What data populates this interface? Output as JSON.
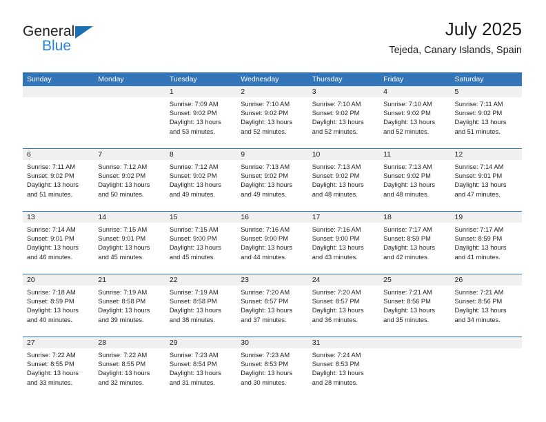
{
  "brand": {
    "name_top": "General",
    "name_bottom": "Blue",
    "triangle_color": "#1c6fb5",
    "blue_color": "#2387d4"
  },
  "header": {
    "title": "July 2025",
    "subtitle": "Tejeda, Canary Islands, Spain",
    "header_bg": "#3275b9",
    "daynum_bg": "#f0f0f0"
  },
  "weekdays": [
    "Sunday",
    "Monday",
    "Tuesday",
    "Wednesday",
    "Thursday",
    "Friday",
    "Saturday"
  ],
  "weeks": [
    [
      {
        "day": "",
        "lines": [
          "",
          "",
          "",
          ""
        ]
      },
      {
        "day": "",
        "lines": [
          "",
          "",
          "",
          ""
        ]
      },
      {
        "day": "1",
        "lines": [
          "Sunrise: 7:09 AM",
          "Sunset: 9:02 PM",
          "Daylight: 13 hours",
          "and 53 minutes."
        ]
      },
      {
        "day": "2",
        "lines": [
          "Sunrise: 7:10 AM",
          "Sunset: 9:02 PM",
          "Daylight: 13 hours",
          "and 52 minutes."
        ]
      },
      {
        "day": "3",
        "lines": [
          "Sunrise: 7:10 AM",
          "Sunset: 9:02 PM",
          "Daylight: 13 hours",
          "and 52 minutes."
        ]
      },
      {
        "day": "4",
        "lines": [
          "Sunrise: 7:10 AM",
          "Sunset: 9:02 PM",
          "Daylight: 13 hours",
          "and 52 minutes."
        ]
      },
      {
        "day": "5",
        "lines": [
          "Sunrise: 7:11 AM",
          "Sunset: 9:02 PM",
          "Daylight: 13 hours",
          "and 51 minutes."
        ]
      }
    ],
    [
      {
        "day": "6",
        "lines": [
          "Sunrise: 7:11 AM",
          "Sunset: 9:02 PM",
          "Daylight: 13 hours",
          "and 51 minutes."
        ]
      },
      {
        "day": "7",
        "lines": [
          "Sunrise: 7:12 AM",
          "Sunset: 9:02 PM",
          "Daylight: 13 hours",
          "and 50 minutes."
        ]
      },
      {
        "day": "8",
        "lines": [
          "Sunrise: 7:12 AM",
          "Sunset: 9:02 PM",
          "Daylight: 13 hours",
          "and 49 minutes."
        ]
      },
      {
        "day": "9",
        "lines": [
          "Sunrise: 7:13 AM",
          "Sunset: 9:02 PM",
          "Daylight: 13 hours",
          "and 49 minutes."
        ]
      },
      {
        "day": "10",
        "lines": [
          "Sunrise: 7:13 AM",
          "Sunset: 9:02 PM",
          "Daylight: 13 hours",
          "and 48 minutes."
        ]
      },
      {
        "day": "11",
        "lines": [
          "Sunrise: 7:13 AM",
          "Sunset: 9:02 PM",
          "Daylight: 13 hours",
          "and 48 minutes."
        ]
      },
      {
        "day": "12",
        "lines": [
          "Sunrise: 7:14 AM",
          "Sunset: 9:01 PM",
          "Daylight: 13 hours",
          "and 47 minutes."
        ]
      }
    ],
    [
      {
        "day": "13",
        "lines": [
          "Sunrise: 7:14 AM",
          "Sunset: 9:01 PM",
          "Daylight: 13 hours",
          "and 46 minutes."
        ]
      },
      {
        "day": "14",
        "lines": [
          "Sunrise: 7:15 AM",
          "Sunset: 9:01 PM",
          "Daylight: 13 hours",
          "and 45 minutes."
        ]
      },
      {
        "day": "15",
        "lines": [
          "Sunrise: 7:15 AM",
          "Sunset: 9:00 PM",
          "Daylight: 13 hours",
          "and 45 minutes."
        ]
      },
      {
        "day": "16",
        "lines": [
          "Sunrise: 7:16 AM",
          "Sunset: 9:00 PM",
          "Daylight: 13 hours",
          "and 44 minutes."
        ]
      },
      {
        "day": "17",
        "lines": [
          "Sunrise: 7:16 AM",
          "Sunset: 9:00 PM",
          "Daylight: 13 hours",
          "and 43 minutes."
        ]
      },
      {
        "day": "18",
        "lines": [
          "Sunrise: 7:17 AM",
          "Sunset: 8:59 PM",
          "Daylight: 13 hours",
          "and 42 minutes."
        ]
      },
      {
        "day": "19",
        "lines": [
          "Sunrise: 7:17 AM",
          "Sunset: 8:59 PM",
          "Daylight: 13 hours",
          "and 41 minutes."
        ]
      }
    ],
    [
      {
        "day": "20",
        "lines": [
          "Sunrise: 7:18 AM",
          "Sunset: 8:59 PM",
          "Daylight: 13 hours",
          "and 40 minutes."
        ]
      },
      {
        "day": "21",
        "lines": [
          "Sunrise: 7:19 AM",
          "Sunset: 8:58 PM",
          "Daylight: 13 hours",
          "and 39 minutes."
        ]
      },
      {
        "day": "22",
        "lines": [
          "Sunrise: 7:19 AM",
          "Sunset: 8:58 PM",
          "Daylight: 13 hours",
          "and 38 minutes."
        ]
      },
      {
        "day": "23",
        "lines": [
          "Sunrise: 7:20 AM",
          "Sunset: 8:57 PM",
          "Daylight: 13 hours",
          "and 37 minutes."
        ]
      },
      {
        "day": "24",
        "lines": [
          "Sunrise: 7:20 AM",
          "Sunset: 8:57 PM",
          "Daylight: 13 hours",
          "and 36 minutes."
        ]
      },
      {
        "day": "25",
        "lines": [
          "Sunrise: 7:21 AM",
          "Sunset: 8:56 PM",
          "Daylight: 13 hours",
          "and 35 minutes."
        ]
      },
      {
        "day": "26",
        "lines": [
          "Sunrise: 7:21 AM",
          "Sunset: 8:56 PM",
          "Daylight: 13 hours",
          "and 34 minutes."
        ]
      }
    ],
    [
      {
        "day": "27",
        "lines": [
          "Sunrise: 7:22 AM",
          "Sunset: 8:55 PM",
          "Daylight: 13 hours",
          "and 33 minutes."
        ]
      },
      {
        "day": "28",
        "lines": [
          "Sunrise: 7:22 AM",
          "Sunset: 8:55 PM",
          "Daylight: 13 hours",
          "and 32 minutes."
        ]
      },
      {
        "day": "29",
        "lines": [
          "Sunrise: 7:23 AM",
          "Sunset: 8:54 PM",
          "Daylight: 13 hours",
          "and 31 minutes."
        ]
      },
      {
        "day": "30",
        "lines": [
          "Sunrise: 7:23 AM",
          "Sunset: 8:53 PM",
          "Daylight: 13 hours",
          "and 30 minutes."
        ]
      },
      {
        "day": "31",
        "lines": [
          "Sunrise: 7:24 AM",
          "Sunset: 8:53 PM",
          "Daylight: 13 hours",
          "and 28 minutes."
        ]
      },
      {
        "day": "",
        "lines": [
          "",
          "",
          "",
          ""
        ]
      },
      {
        "day": "",
        "lines": [
          "",
          "",
          "",
          ""
        ]
      }
    ]
  ]
}
